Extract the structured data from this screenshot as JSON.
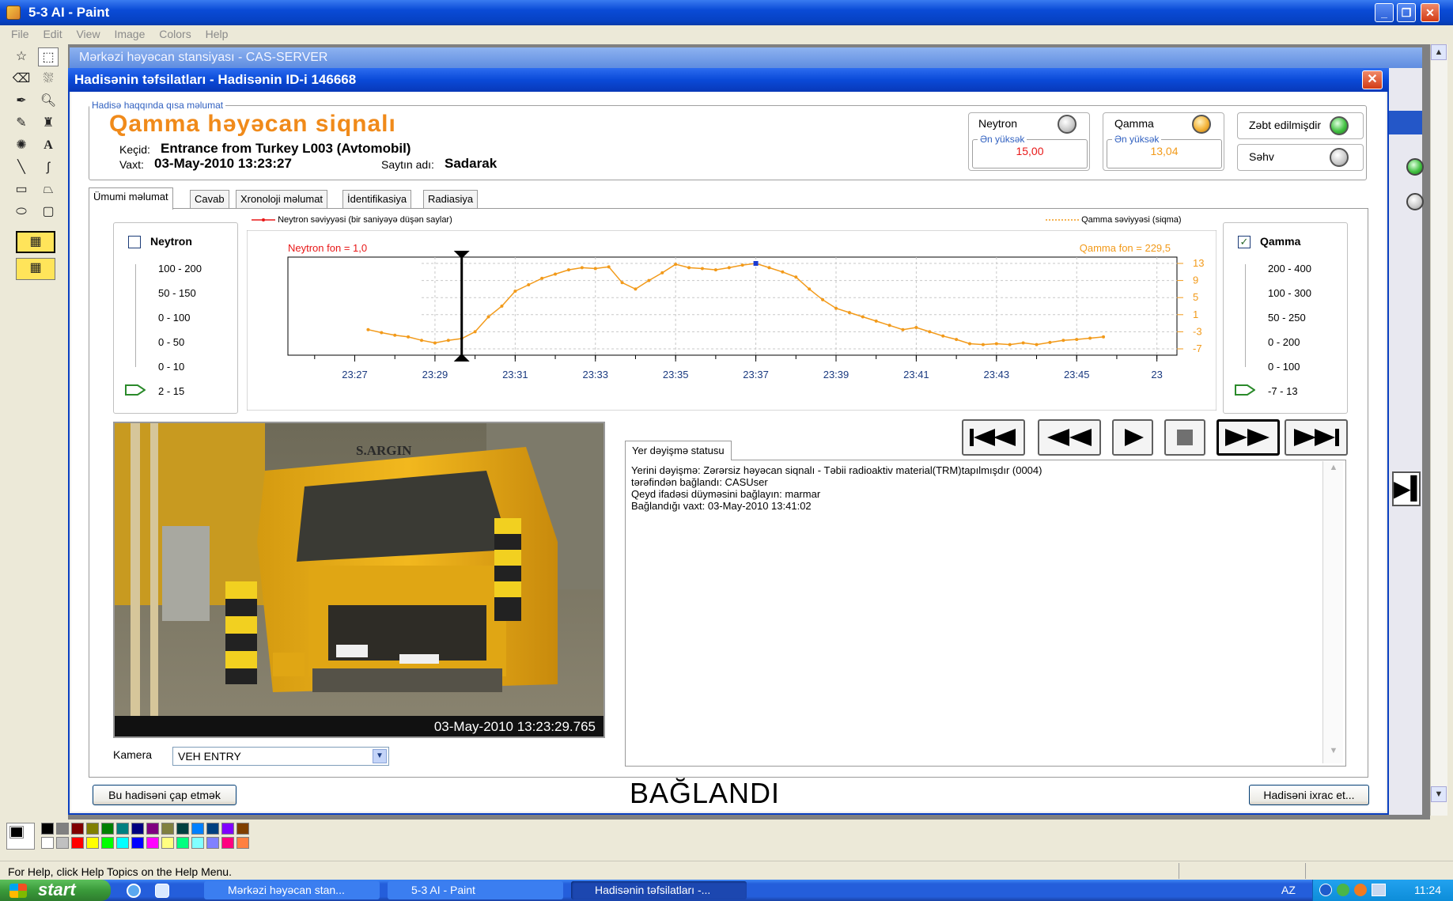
{
  "paint": {
    "title": "5-3 AI - Paint",
    "menu": [
      "File",
      "Edit",
      "View",
      "Image",
      "Colors",
      "Help"
    ],
    "status_bar": "For Help, click Help Topics on the Help Menu.",
    "palette_colors": [
      "#000000",
      "#808080",
      "#800000",
      "#808000",
      "#008000",
      "#008080",
      "#000080",
      "#800080",
      "#808040",
      "#004040",
      "#0080ff",
      "#004080",
      "#8000ff",
      "#804000",
      "#ffffff",
      "#c0c0c0",
      "#ff0000",
      "#ffff00",
      "#00ff00",
      "#00ffff",
      "#0000ff",
      "#ff00ff",
      "#ffff80",
      "#00ff80",
      "#80ffff",
      "#8080ff",
      "#ff0080",
      "#ff8040"
    ]
  },
  "background_window": {
    "title": "Mərkəzi həyəcan stansiyası - CAS-SERVER"
  },
  "dialog": {
    "title": "Hadisənin təfsilatları - Hadisənin ID-i 146668",
    "summary_legend": "Hadisə haqqında qısa məlumat",
    "alarm_type": "Qamma həyəcan siqnalı",
    "lane_label": "Keçid:",
    "lane_value": "Entrance from Turkey L003  (Avtomobil)",
    "time_label": "Vaxt:",
    "time_value": "03-May-2010  13:23:27",
    "site_label": "Saytın adı:",
    "site_value": "Sadarak",
    "neutron": {
      "label": "Neytron",
      "peak_legend": "Ən yüksək",
      "peak_value": "15,00",
      "led": "gray"
    },
    "gamma": {
      "label": "Qamma",
      "peak_legend": "Ən yüksək",
      "peak_value": "13,04",
      "led": "orange"
    },
    "seized": {
      "label": "Zəbt edilmişdir",
      "led": "green"
    },
    "error": {
      "label": "Səhv",
      "led": "gray"
    },
    "tabs": [
      "Ümumi məlumat",
      "Cavab",
      "Xronoloji məlumat",
      "İdentifikasiya",
      "Radiasiya"
    ],
    "active_tab": 0,
    "neutron_panel": {
      "title": "Neytron",
      "checked": false,
      "ranges": [
        "100 - 200",
        "50 - 150",
        "0 - 100",
        "0 - 50",
        "0 - 10",
        "2 - 15"
      ],
      "selected": "2 - 15"
    },
    "gamma_panel": {
      "title": "Qamma",
      "checked": true,
      "ranges": [
        "200 - 400",
        "100 - 300",
        "50 - 250",
        "0 - 200",
        "0 - 100",
        "-7 - 13"
      ],
      "selected": "-7 - 13"
    },
    "video_timestamp": "03-May-2010  13:23:29.765",
    "video_truck_text": "S.ARGIN",
    "camera_label": "Kamera",
    "camera_value": "VEH ENTRY",
    "media_controls": [
      "first-icon",
      "rewind-icon",
      "play-icon",
      "stop-icon",
      "fast-forward-icon",
      "last-icon"
    ],
    "status_tab": "Yer dəyişmə statusu",
    "status_lines": [
      "Yerini dəyişmə: Zərərsiz həyəcan siqnalı - Təbii radioaktiv material(TRM)tapılmışdır (0004)",
      "tərəfindən bağlandı: CASUser",
      "Qeyd ifadəsi düyməsini bağlayın: marmar",
      "Bağlandığı vaxt: 03-May-2010  13:41:02"
    ],
    "print_button": "Bu hadisəni çap etmək",
    "closed_status": "BAĞLANDI",
    "export_button": "Hadisəni ixrac et..."
  },
  "chart_data": {
    "type": "line",
    "series": [
      {
        "name": "Neytron səviyyəsi (bir saniyəyə düşən saylar)",
        "color": "#e81818",
        "values": []
      },
      {
        "name": "Qamma səviyyəsi (siqma)",
        "color": "#f29a1a",
        "x": [
          "23:27:20",
          "23:27:40",
          "23:28:00",
          "23:28:20",
          "23:28:40",
          "23:29:00",
          "23:29:20",
          "23:29:40",
          "23:30:00",
          "23:30:20",
          "23:30:40",
          "23:31:00",
          "23:31:20",
          "23:31:40",
          "23:32:00",
          "23:32:20",
          "23:32:40",
          "23:33:00",
          "23:33:20",
          "23:33:40",
          "23:34:00",
          "23:34:20",
          "23:34:40",
          "23:35:00",
          "23:35:20",
          "23:35:40",
          "23:36:00",
          "23:36:20",
          "23:36:40",
          "23:37:00",
          "23:37:20",
          "23:37:40",
          "23:38:00",
          "23:38:20",
          "23:38:40",
          "23:39:00",
          "23:39:20",
          "23:39:40",
          "23:40:00",
          "23:40:20",
          "23:40:40",
          "23:41:00",
          "23:41:20",
          "23:41:40",
          "23:42:00",
          "23:42:20",
          "23:42:40",
          "23:43:00",
          "23:43:20",
          "23:43:40",
          "23:44:00",
          "23:44:20",
          "23:44:40",
          "23:45:00",
          "23:45:20",
          "23:45:40"
        ],
        "values": [
          -2.5,
          -3.2,
          -3.8,
          -4.2,
          -5.0,
          -5.6,
          -5.0,
          -4.6,
          -3.0,
          0.5,
          3.0,
          6.5,
          8.0,
          9.5,
          10.5,
          11.5,
          12.0,
          11.8,
          12.2,
          8.5,
          7.0,
          9.0,
          10.8,
          12.8,
          12.0,
          11.8,
          11.5,
          12.0,
          12.6,
          13.0,
          12.0,
          11.0,
          9.8,
          7.0,
          4.5,
          2.5,
          1.5,
          0.5,
          -0.5,
          -1.5,
          -2.5,
          -2.0,
          -3.0,
          -4.0,
          -4.8,
          -5.8,
          -6.0,
          -5.8,
          -6.0,
          -5.6,
          -6.0,
          -5.5,
          -5.0,
          -4.8,
          -4.5,
          -4.2
        ]
      }
    ],
    "x_ticks": [
      "23:27",
      "23:29",
      "23:31",
      "23:33",
      "23:35",
      "23:37",
      "23:39",
      "23:41",
      "23:43",
      "23:45",
      "23"
    ],
    "y_right_ticks": [
      "13",
      "9",
      "5",
      "1",
      "-3",
      "-7"
    ],
    "ylim": [
      -7,
      13
    ],
    "neutron_background": "Neytron fon = 1,0",
    "gamma_background": "Qamma fon = 229,5",
    "background_period_shaded": true,
    "grid": true
  },
  "taskbar": {
    "start": "start",
    "tasks": [
      "Mərkəzi həyəcan stan...",
      "5-3 AI - Paint",
      "Hadisənin təfsilatları -..."
    ],
    "active_task": 2,
    "lang": "AZ",
    "clock": "11:24"
  }
}
